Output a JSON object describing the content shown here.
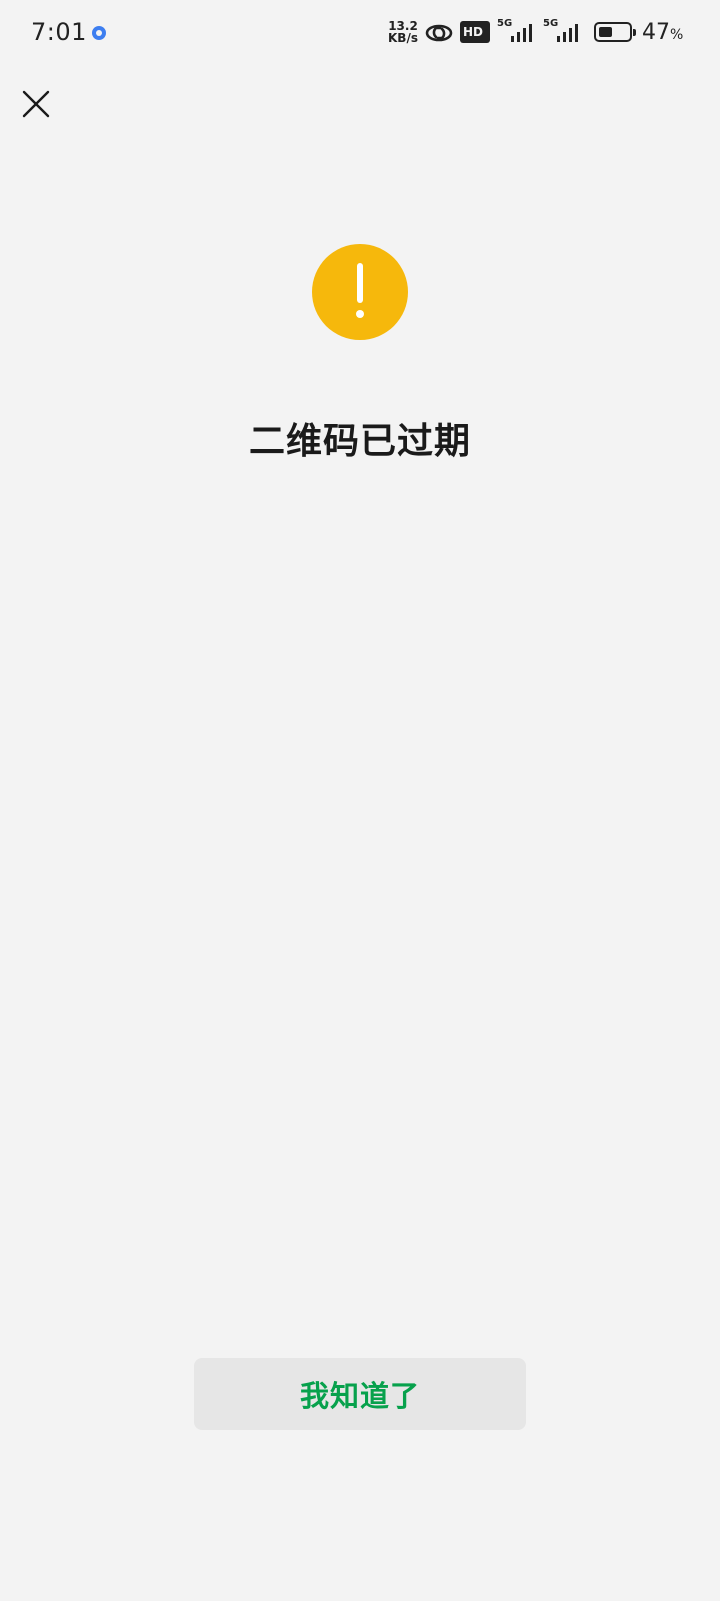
{
  "status_bar": {
    "time": "7:01",
    "app_icon": "notification-app-icon",
    "net_speed_value": "13.2",
    "net_speed_unit": "KB/s",
    "hd_label": "HD",
    "signal_1_label": "5G",
    "signal_2_label": "5G",
    "battery_percent": "47",
    "battery_percent_sign": "%",
    "battery_level": 0.47
  },
  "header": {
    "close_icon": "close-icon"
  },
  "main": {
    "status_icon": "warning-exclamation-icon",
    "status_color": "#F6B80C",
    "title": "二维码已过期"
  },
  "footer": {
    "confirm_label": "我知道了",
    "confirm_color": "#07A14C"
  }
}
